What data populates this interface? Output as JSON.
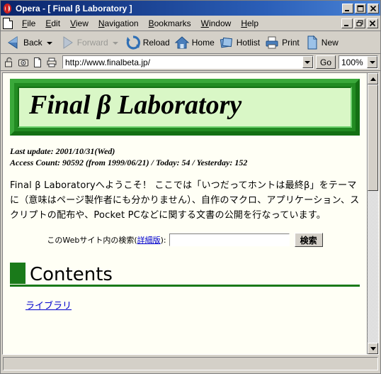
{
  "window": {
    "title": "Opera - [ Final β  Laboratory ]",
    "icon": "opera-icon",
    "buttons": {
      "minimize": "_",
      "maximize": "□",
      "close": "✕",
      "restore": "❐"
    }
  },
  "menubar": {
    "items": [
      {
        "label": "File",
        "accel": "F"
      },
      {
        "label": "Edit",
        "accel": "E"
      },
      {
        "label": "View",
        "accel": "V"
      },
      {
        "label": "Navigation",
        "accel": "N"
      },
      {
        "label": "Bookmarks",
        "accel": "B"
      },
      {
        "label": "Window",
        "accel": "W"
      },
      {
        "label": "Help",
        "accel": "H"
      }
    ]
  },
  "toolbar": {
    "buttons": [
      {
        "label": "Back",
        "icon": "back-arrow-icon",
        "disabled": false,
        "dropdown": true
      },
      {
        "label": "Forward",
        "icon": "forward-arrow-icon",
        "disabled": true,
        "dropdown": true
      },
      {
        "label": "Reload",
        "icon": "reload-icon",
        "disabled": false,
        "dropdown": false
      },
      {
        "label": "Home",
        "icon": "home-icon",
        "disabled": false,
        "dropdown": false
      },
      {
        "label": "Hotlist",
        "icon": "hotlist-icon",
        "disabled": false,
        "dropdown": false
      },
      {
        "label": "Print",
        "icon": "printer-icon",
        "disabled": false,
        "dropdown": false
      },
      {
        "label": "New",
        "icon": "new-page-icon",
        "disabled": false,
        "dropdown": false
      }
    ]
  },
  "addressbar": {
    "icons": [
      "padlock-icon",
      "camera-icon",
      "page-icon",
      "print-icon"
    ],
    "url": "http://www.finalbeta.jp/",
    "go_label": "Go",
    "zoom": "100%"
  },
  "page": {
    "banner_title": "Final β Laboratory",
    "meta_line1": "Last update: 2001/10/31(Wed)",
    "meta_line2": "Access Count: 90592 (from 1999/06/21) / Today: 54 / Yesterday: 152",
    "intro": "Final β Laboratoryへようこそ！ ここでは「いつだってホントは最終β」をテーマに（意味はページ製作者にも分かりません）、自作のマクロ、アプリケーション、スクリプトの配布や、Pocket PCなどに関する文書の公開を行なっています。",
    "search": {
      "label_prefix": "このWebサイト内の検索(",
      "advanced_link": "詳細版",
      "label_suffix": "):",
      "input_value": "",
      "button_label": "検索"
    },
    "contents_heading": "Contents",
    "links": [
      {
        "label": "ライブラリ"
      }
    ]
  },
  "statusbar": {
    "text": ""
  },
  "colors": {
    "title_gradient_start": "#0a246a",
    "title_gradient_end": "#4a84d6",
    "chrome": "#d4d0c8",
    "page_bg": "#fffff5",
    "banner_border": "#228b22",
    "banner_fill": "#d9f7c6",
    "heading_green": "#1a7a1a",
    "link_blue": "#0000cc"
  }
}
